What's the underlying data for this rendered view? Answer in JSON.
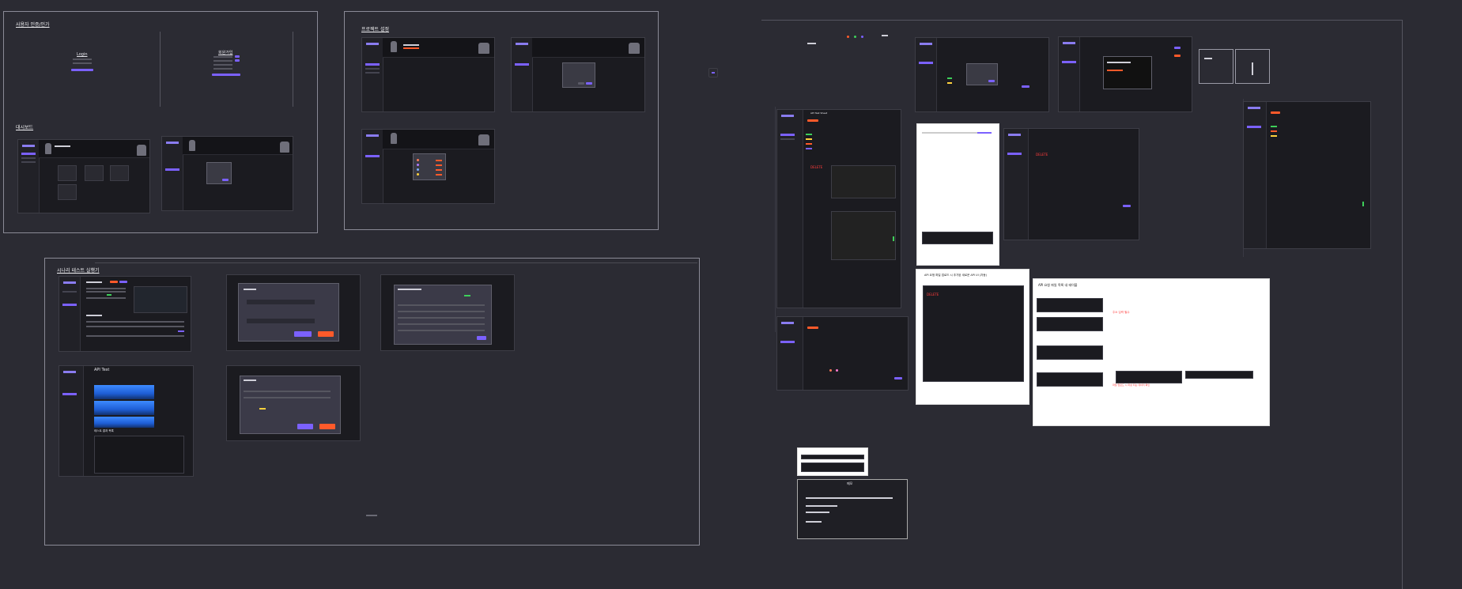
{
  "sections": {
    "user_auth": {
      "title": "사용자 인증/인가"
    },
    "dashboard": {
      "title": "대시보드"
    },
    "project_settings": {
      "title": "프로젝트 설정"
    },
    "test_execution": {
      "title": "시나리 테스트 실행기"
    }
  },
  "auth": {
    "login_title": "Login",
    "signup_title": "회원가입"
  },
  "api_editor": {
    "frame_title": "API Test Sheet",
    "method_label": "DELETE"
  },
  "notes": {
    "api_file_title": "API 요청 파일 업로드 시 추가된 새로운 API UI (자동)",
    "api_table_title": "API 요청 파일 목록 내 테이블",
    "memo_title": "메모",
    "red_note_a": "주소 입력 필수",
    "red_note_b": "파일 업로드 시 파싱 되는 데이터 확인",
    "run_title": "API Test",
    "result_title": "테스트 결과 목록"
  },
  "colors": {
    "background": "#2b2b33",
    "frame": "#1b1b20",
    "accent": "#7b61ff",
    "danger": "#ff5a2a",
    "success": "#3ecf5a"
  }
}
